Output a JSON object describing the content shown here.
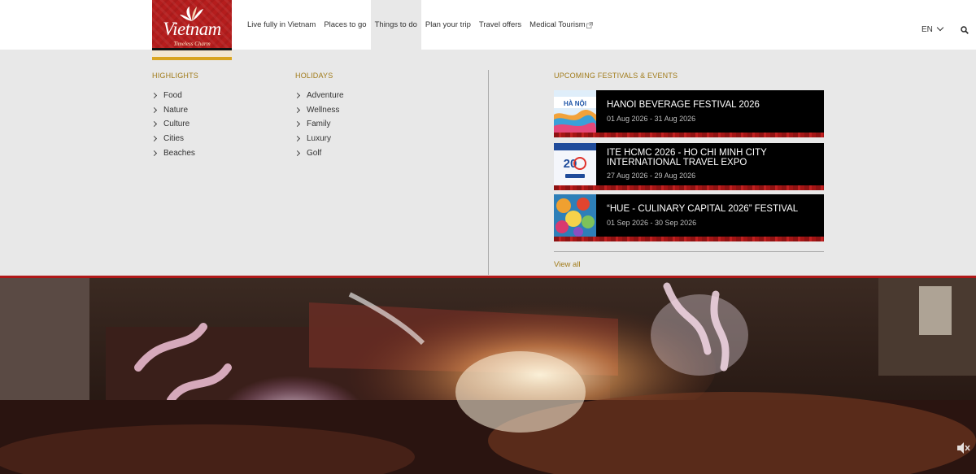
{
  "header": {
    "logo": {
      "brand": "Vietnam",
      "tagline": "Timeless Charm"
    },
    "nav": [
      {
        "label": "Live fully in Vietnam",
        "active": false
      },
      {
        "label": "Places to go",
        "active": false
      },
      {
        "label": "Things to do",
        "active": true
      },
      {
        "label": "Plan your trip",
        "active": false
      },
      {
        "label": "Travel offers",
        "active": false
      },
      {
        "label": "Medical Tourism",
        "active": false,
        "icon": "external-link-icon"
      }
    ],
    "language": "EN",
    "icons": {
      "language": "chevron-down-icon",
      "search": "search-icon"
    }
  },
  "mega_menu": {
    "highlights": {
      "heading": "HIGHLIGHTS",
      "items": [
        "Food",
        "Nature",
        "Culture",
        "Cities",
        "Beaches"
      ]
    },
    "holidays": {
      "heading": "HOLIDAYS",
      "items": [
        "Adventure",
        "Wellness",
        "Family",
        "Luxury",
        "Golf"
      ]
    },
    "events": {
      "heading": "UPCOMING FESTIVALS & EVENTS",
      "items": [
        {
          "title": "HANOI BEVERAGE FESTIVAL 2026",
          "date": "01 Aug 2026 - 31 Aug 2026"
        },
        {
          "title": "ITE HCMC 2026 - HO CHI MINH CITY INTERNATIONAL TRAVEL EXPO",
          "date": "27 Aug 2026 - 29 Aug 2026"
        },
        {
          "title": "“HUE - CULINARY CAPITAL 2026” FESTIVAL",
          "date": "01 Sep 2026 - 30 Sep 2026"
        }
      ],
      "view_all": "View all"
    }
  },
  "hero": {
    "type": "video",
    "icons": {
      "mute": "speaker-muted-icon"
    }
  },
  "colors": {
    "brand_red": "#b51d1d",
    "accent_gold": "#a07a18",
    "menu_bg": "#e8e8e8"
  }
}
